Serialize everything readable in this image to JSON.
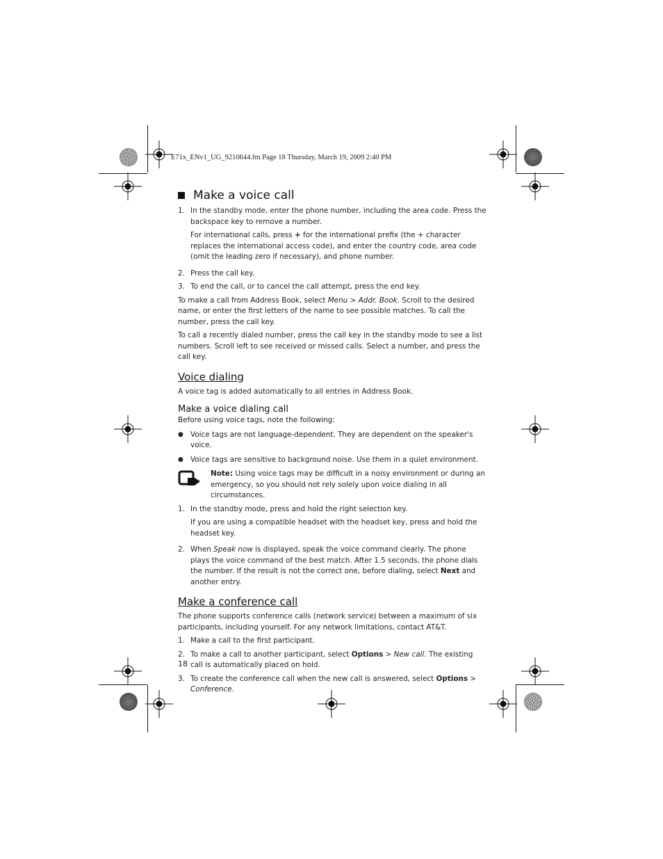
{
  "header": {
    "print_line": "E71x_ENv1_UG_9210644.fm  Page 18  Thursday, March 19, 2009  2:40 PM"
  },
  "section_main": {
    "title": "Make a voice call",
    "steps": [
      {
        "num": "1.",
        "text": "In the standby mode, enter the phone number, including the area code. Press the backspace key to remove a number.",
        "sub_pre": "For international calls, press ",
        "sub_bold": "+",
        "sub_post": " for the international prefix (the + character replaces the international access code), and enter the country code, area code (omit the leading zero if necessary), and phone number."
      },
      {
        "num": "2.",
        "text": "Press the call key."
      },
      {
        "num": "3.",
        "text": "To end the call, or to cancel the call attempt, press the end key."
      }
    ],
    "para_addr_pre": "To make a call from Address Book, select ",
    "para_addr_menu": "Menu",
    "para_addr_sep": " > ",
    "para_addr_book": "Addr. Book",
    "para_addr_post": ". Scroll to the desired name, or enter the first letters of the name to see possible matches. To call the number, press the call key.",
    "para_recent": "To call a recently dialed number, press the call key in the standby mode to see a list numbers. Scroll left to see received or missed calls. Select a number, and press the call key."
  },
  "section_voice": {
    "title": "Voice dialing",
    "intro": "A voice tag is added automatically to all entries in Address Book.",
    "subtitle": "Make a voice dialing call",
    "sub_intro": "Before using voice tags, note the following:",
    "bullets": [
      "Voice tags are not language-dependent. They are dependent on the speaker's voice.",
      "Voice tags are sensitive to background noise. Use them in a quiet environment."
    ],
    "note_label": "Note:",
    "note_text": " Using voice tags may be difficult in a noisy environment or during an emergency, so you should not rely solely upon voice dialing in all circumstances.",
    "steps": [
      {
        "num": "1.",
        "text": "In the standby mode, press and hold the right selection key.",
        "sub": "If you are using a compatible headset with the headset key, press and hold the headset key."
      },
      {
        "num": "2.",
        "pre": "When ",
        "italic": "Speak now",
        "mid": " is displayed, speak the voice command clearly. The phone plays the voice command of the best match. After 1.5 seconds, the phone dials the number. If the result is not the correct one, before dialing, select ",
        "bold": "Next",
        "post": " and another entry."
      }
    ]
  },
  "section_conf": {
    "title": "Make a conference call",
    "intro": "The phone supports conference calls (network service) between a maximum of six participants, including yourself. For any network limitations, contact AT&T.",
    "steps": [
      {
        "num": "1.",
        "text": " Make a call to the first participant."
      },
      {
        "num": "2.",
        "pre": "To make a call to another participant, select ",
        "bold": "Options",
        "sep": " > ",
        "italic": "New call",
        "post": ". The existing call is automatically placed on hold."
      },
      {
        "num": "3.",
        "pre": "To create the conference call when the new call is answered, select ",
        "bold": "Options",
        "sep": " > ",
        "italic": "Conference",
        "post": "."
      }
    ]
  },
  "footer": {
    "page_number": "18"
  }
}
